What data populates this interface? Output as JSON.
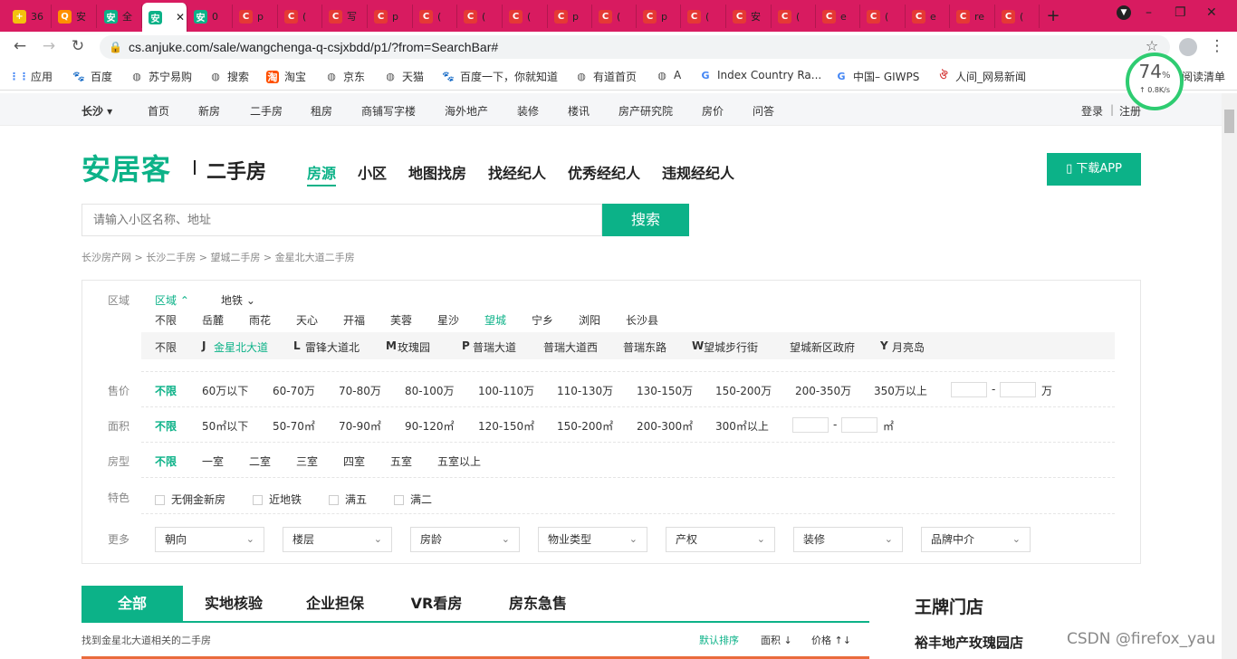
{
  "browser": {
    "tabs": [
      {
        "label": "36",
        "icon_color": "#f4c20d",
        "icon_text": "+"
      },
      {
        "label": "安",
        "icon_color": "#ff8f00",
        "icon_text": "Q"
      },
      {
        "label": "全",
        "icon_color": "#0cb288",
        "icon_text": "安"
      },
      {
        "label": "",
        "icon_color": "#0cb288",
        "icon_text": "安"
      },
      {
        "label": "0",
        "icon_color": "#0cb288",
        "icon_text": "安"
      },
      {
        "label": "p",
        "icon_color": "#e53935",
        "icon_text": "C"
      },
      {
        "label": "(",
        "icon_color": "#e53935",
        "icon_text": "C"
      },
      {
        "label": "写",
        "icon_color": "#e53935",
        "icon_text": "C"
      },
      {
        "label": "p",
        "icon_color": "#e53935",
        "icon_text": "C"
      },
      {
        "label": "(",
        "icon_color": "#e53935",
        "icon_text": "C"
      },
      {
        "label": "(",
        "icon_color": "#e53935",
        "icon_text": "C"
      },
      {
        "label": "(",
        "icon_color": "#e53935",
        "icon_text": "C"
      },
      {
        "label": "p",
        "icon_color": "#e53935",
        "icon_text": "C"
      },
      {
        "label": "(",
        "icon_color": "#e53935",
        "icon_text": "C"
      },
      {
        "label": "p",
        "icon_color": "#e53935",
        "icon_text": "C"
      },
      {
        "label": "(",
        "icon_color": "#e53935",
        "icon_text": "C"
      },
      {
        "label": "安",
        "icon_color": "#e53935",
        "icon_text": "C"
      },
      {
        "label": "(",
        "icon_color": "#e53935",
        "icon_text": "C"
      },
      {
        "label": "e",
        "icon_color": "#e53935",
        "icon_text": "C"
      },
      {
        "label": "(",
        "icon_color": "#e53935",
        "icon_text": "C"
      },
      {
        "label": "e",
        "icon_color": "#e53935",
        "icon_text": "C"
      },
      {
        "label": "re",
        "icon_color": "#e53935",
        "icon_text": "C"
      },
      {
        "label": "(",
        "icon_color": "#e53935",
        "icon_text": "C"
      }
    ],
    "url": "cs.anjuke.com/sale/wangchenga-q-csjxbdd/p1/?from=SearchBar#",
    "bookmarks": [
      "应用",
      "百度",
      "苏宁易购",
      "搜索",
      "淘宝",
      "京东",
      "天猫",
      "百度一下，你就知道",
      "有道首页",
      "A",
      "Index Country Ra...",
      "中国– GIWPS",
      "人间_网易新闻",
      "阅读清单"
    ],
    "speed": {
      "percent": "74",
      "unit": "%",
      "rate": "↑ 0.8K/s"
    }
  },
  "site_nav": {
    "city": "长沙 ▾",
    "items": [
      "首页",
      "新房",
      "二手房",
      "租房",
      "商铺写字楼",
      "海外地产",
      "装修",
      "楼讯",
      "房产研究院",
      "房价",
      "问答"
    ],
    "login": "登录",
    "sep": "|",
    "register": "注册"
  },
  "header": {
    "logo": "安居客",
    "section": "二手房",
    "nav": [
      "房源",
      "小区",
      "地图找房",
      "找经纪人",
      "优秀经纪人",
      "违规经纪人"
    ],
    "download": "▯ 下载APP"
  },
  "search": {
    "placeholder": "请输入小区名称、地址",
    "button": "搜索"
  },
  "breadcrumb": "长沙房产网 > 长沙二手房 > 望城二手房 > 金星北大道二手房",
  "filter": {
    "region_label": "区域",
    "region_tab": "区域 ⌃",
    "metro_tab": "地铁 ⌄",
    "districts": [
      "不限",
      "岳麓",
      "雨花",
      "天心",
      "开福",
      "芙蓉",
      "星沙",
      "望城",
      "宁乡",
      "浏阳",
      "长沙县"
    ],
    "streets": [
      "不限",
      "J",
      "金星北大道",
      "L",
      "雷锋大道北",
      "M",
      "玫瑰园",
      "P",
      "普瑞大道",
      "普瑞大道西",
      "普瑞东路",
      "W",
      "望城步行街",
      "望城新区政府",
      "Y",
      "月亮岛"
    ],
    "price_label": "售价",
    "prices": [
      "不限",
      "60万以下",
      "60-70万",
      "70-80万",
      "80-100万",
      "100-110万",
      "110-130万",
      "130-150万",
      "150-200万",
      "200-350万",
      "350万以上"
    ],
    "price_dash": "-",
    "price_unit": "万",
    "area_label": "面积",
    "areas": [
      "不限",
      "50㎡以下",
      "50-70㎡",
      "70-90㎡",
      "90-120㎡",
      "120-150㎡",
      "150-200㎡",
      "200-300㎡",
      "300㎡以上"
    ],
    "area_dash": "-",
    "area_unit": "㎡",
    "rooms_label": "房型",
    "rooms": [
      "不限",
      "一室",
      "二室",
      "三室",
      "四室",
      "五室",
      "五室以上"
    ],
    "feature_label": "特色",
    "features": [
      "无佣金新房",
      "近地铁",
      "满五",
      "满二"
    ],
    "more_label": "更多",
    "dropdowns": [
      "朝向",
      "楼层",
      "房龄",
      "物业类型",
      "产权",
      "装修",
      "品牌中介"
    ],
    "arrow": "⌄"
  },
  "list_tabs": [
    "全部",
    "实地核验",
    "企业担保",
    "VR看房",
    "房东急售"
  ],
  "result_text": "找到金星北大道相关的二手房",
  "sort": {
    "default": "默认排序",
    "area": "面积 ↓",
    "price": "价格 ↑↓"
  },
  "sidebar": {
    "title": "王牌门店",
    "store": "裕丰地产玫瑰园店"
  },
  "watermark": "CSDN @firefox_yau"
}
